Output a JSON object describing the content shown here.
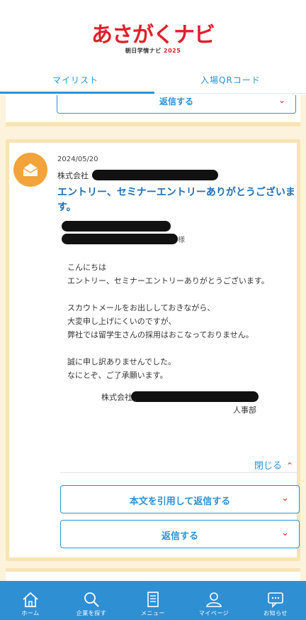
{
  "header": {
    "logo_main": "あさがくナビ",
    "logo_sub": "朝日学情ナビ",
    "logo_year": "2025"
  },
  "tabs": [
    {
      "label": "マイリスト",
      "active": true
    },
    {
      "label": "入場QRコード",
      "active": false
    }
  ],
  "previous_card": {
    "reply_label": "返信する"
  },
  "message": {
    "date": "2024/05/20",
    "company_prefix": "株式会社",
    "subject": "エントリー、セミナーエントリーありがとうございます。",
    "recipient_suffix": "様",
    "body": [
      "こんにちは",
      "エントリー、セミナーエントリーありがとうございます。",
      "",
      "スカウトメールをお出ししておきながら、",
      "大変申し上げにくいのですが、",
      "弊社では留学生さんの採用はおこなっておりません。",
      "",
      "誠に申し訳ありませんでした。",
      "なにとぞ、ご了承願います。"
    ],
    "signature_company": "株式会社",
    "signature_dept": "人事部",
    "close_label": "閉じる",
    "quote_reply_label": "本文を引用して返信する",
    "reply_label": "返信する"
  },
  "colors": {
    "brand_red": "#e0202a",
    "accent_blue": "#2b93d4",
    "nav_blue": "#2f8fd3",
    "card_border": "#f7e3b4",
    "avatar_orange": "#f2a33a"
  },
  "bottom_nav": [
    {
      "label": "ホーム",
      "icon": "home-icon"
    },
    {
      "label": "企業を探す",
      "icon": "search-icon"
    },
    {
      "label": "メニュー",
      "icon": "menu-document-icon"
    },
    {
      "label": "マイページ",
      "icon": "user-icon"
    },
    {
      "label": "お知らせ",
      "icon": "message-icon"
    }
  ]
}
